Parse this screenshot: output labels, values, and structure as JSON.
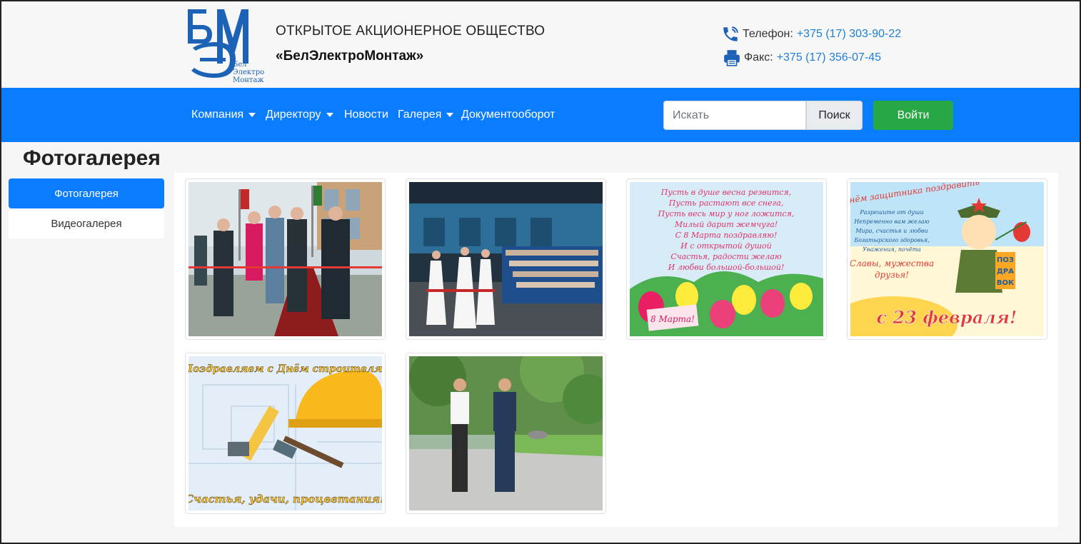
{
  "header": {
    "logo_text": [
      "Бел",
      "Электро",
      "Монтаж"
    ],
    "company_line1": "ОТКРЫТОЕ АКЦИОНЕРНОЕ ОБЩЕСТВО",
    "company_line2": "«БелЭлектроМонтаж»",
    "phone_label": "Телефон:",
    "phone_value": "+375 (17) 303-90-22",
    "fax_label": "Факс:",
    "fax_value": "+375 (17) 356-07-45"
  },
  "nav": {
    "items": [
      {
        "label": "Компания",
        "icon": "caret-down-icon"
      },
      {
        "label": "Директору",
        "icon": "caret-down-icon"
      },
      {
        "label": "Новости"
      },
      {
        "label": "Галерея",
        "icon": "caret-down-icon"
      },
      {
        "label": "Документооборот"
      }
    ],
    "search_placeholder": "Искать",
    "search_button": "Поиск",
    "login_button": "Войти"
  },
  "page": {
    "title": "Фотогалерея",
    "sidebar": [
      {
        "label": "Фотогалерея",
        "active": true
      },
      {
        "label": "Видеогалерея",
        "active": false
      }
    ]
  },
  "gallery": {
    "photos": [
      {
        "subject": "ribbon-cutting-ceremony-photo"
      },
      {
        "subject": "concert-hall-dance-photo"
      },
      {
        "subject": "march-8-greeting-card",
        "lines": [
          "Пусть в душе весна резвится,",
          "Пусть растают все снега,",
          "Пусть весь мир у ног ложится,",
          "Милый дарит жемчуга!",
          "С 8 Марта поздравляю!",
          "И с открытой душой",
          "Счастья, радости желаю",
          "И любви большой-большой!"
        ],
        "tag": "8 Марта!"
      },
      {
        "subject": "february-23-greeting-card",
        "lines": [
          "С днём защитника поздравить",
          "Разрешите от души",
          "Непременно вам желаю",
          "Мира, счастья и любви",
          "Богатырского здоровья,",
          "Уважения, почёта",
          "Славы, мужества",
          "друзья!"
        ],
        "badge": [
          "ПОЗ",
          "ДРА",
          "ВОК"
        ],
        "footer": "с 23 февраля!"
      },
      {
        "subject": "builders-day-greeting-card",
        "top": "Поздравляем с Днём строителя!",
        "bottom": "Счастья, удачи, процветания!"
      },
      {
        "subject": "officials-walking-photo"
      }
    ]
  },
  "colors": {
    "navbar": "#0a7cff",
    "login": "#28a745",
    "link": "#1e7fd6",
    "logo_blue": "#1c63b8"
  }
}
